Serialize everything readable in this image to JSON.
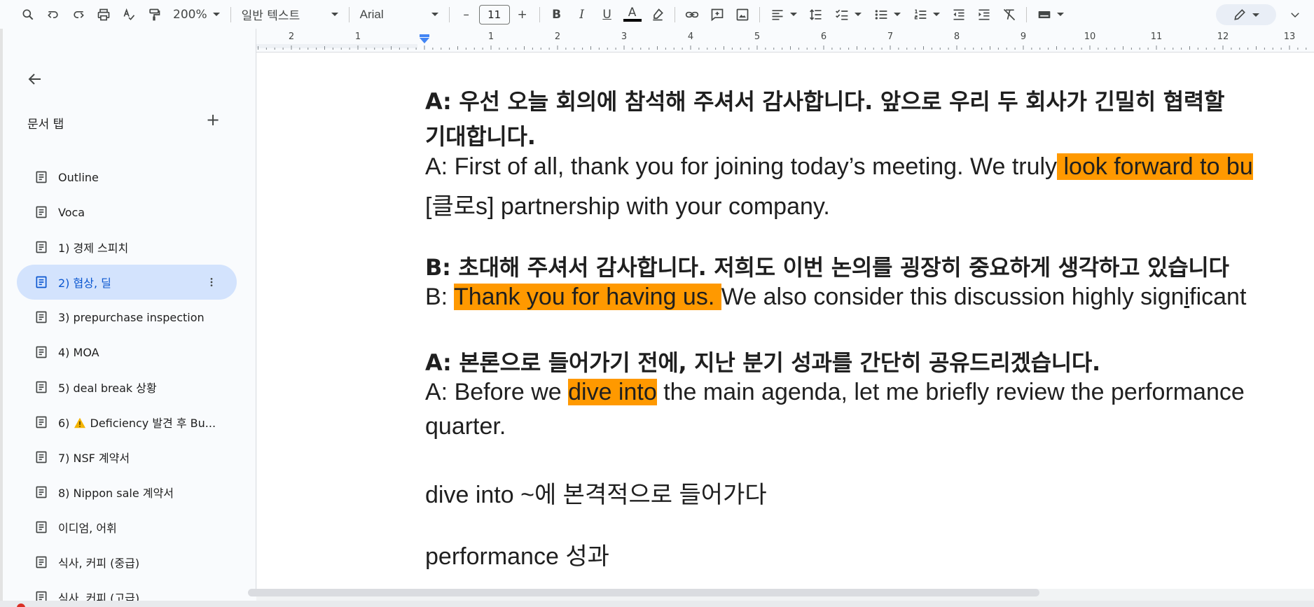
{
  "toolbar": {
    "zoom": "200%",
    "style": "일반 텍스트",
    "font": "Arial",
    "font_size": "11",
    "bold": "B",
    "italic": "I",
    "underline": "U",
    "text_color": "A",
    "minus": "–",
    "plus": "+"
  },
  "sidebar": {
    "header": "문서 탭",
    "add": "+",
    "items": [
      {
        "label": "Outline"
      },
      {
        "label": "Voca"
      },
      {
        "label": "1) 경제 스피치"
      },
      {
        "label": "2) 협상, 딜",
        "active": true
      },
      {
        "label": "3) prepurchase inspection"
      },
      {
        "label": "4) MOA"
      },
      {
        "label": "5) deal break 상황"
      },
      {
        "label_prefix": "6) ",
        "label": "Deficiency 발견 후 Bu...",
        "warning": true
      },
      {
        "label": "7) NSF 계약서"
      },
      {
        "label": "8) Nippon sale 계약서"
      },
      {
        "label": "이디엄, 어휘"
      },
      {
        "label": "식사, 커피 (중급)"
      },
      {
        "label": "식사, 커피 (고급)"
      }
    ]
  },
  "ruler": {
    "labels": [
      "2",
      "1",
      "1",
      "2",
      "3",
      "4",
      "5",
      "6",
      "7",
      "8",
      "9",
      "10",
      "11",
      "12",
      "13"
    ]
  },
  "document": {
    "p1_ko_line1": "A: 우선 오늘 회의에 참석해 주셔서 감사합니다. 앞으로 우리 두 회사가 긴밀히 협력할",
    "p1_ko_line2": "기대합니다.",
    "p1_en_line1_a": " A: First of all, thank you for joining today’s meeting. We truly",
    "p1_en_line1_hl": " look forward to bu",
    "p1_en_line2": "[클로s] partnership with your company.",
    "p2_ko": "B: 초대해 주셔서 감사합니다. 저희도 이번 논의를 굉장히 중요하게 생각하고 있습니다",
    "p2_en_a": " B: ",
    "p2_en_hl": "Thank you for having us. ",
    "p2_en_b": "We also consider this discussion highly sign",
    "p2_en_u": "i",
    "p2_en_c": "ficant",
    "p3_ko": "A: 본론으로 들어가기 전에, 지난 분기 성과를 간단히 공유드리겠습니다.",
    "p3_en_a": " A: Before we ",
    "p3_en_hl": "dive into",
    "p3_en_b": " the main agenda, let me briefly review the performance",
    "p3_en_line2": "quarter.",
    "note1": "dive into ~에 본격적으로 들어가다",
    "note2": "performance 성과"
  },
  "colors": {
    "highlight": "#ff9900",
    "active_tab_bg": "#d3e3fd",
    "active_tab_text": "#0b57d0"
  }
}
